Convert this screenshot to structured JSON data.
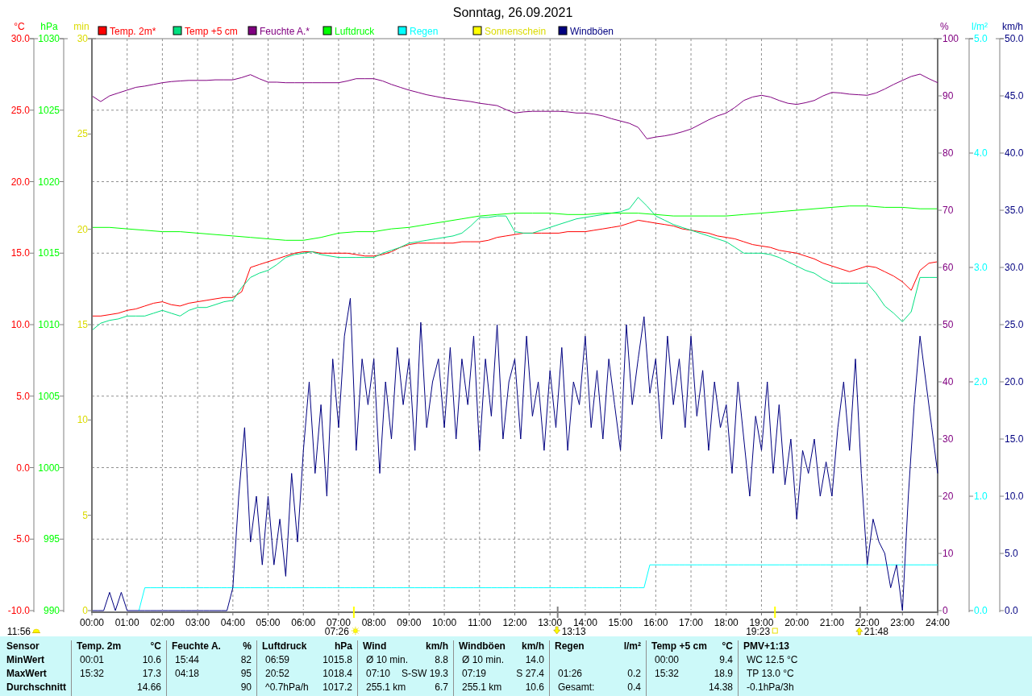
{
  "charts": [
    {
      "chart_data": {
        "type": "line",
        "title": "Sonntag, 26.09.2021",
        "ylabel": "°C",
        "grid": true,
        "legend": "top",
        "xlim": [
          0,
          1440
        ],
        "ylim": [
          -10,
          30
        ],
        "xticks": [
          {
            "value": 0,
            "label": "00:00"
          },
          {
            "value": 60,
            "label": "01:00"
          },
          {
            "value": 120,
            "label": "02:00"
          },
          {
            "value": 180,
            "label": "03:00"
          },
          {
            "value": 240,
            "label": "04:00"
          },
          {
            "value": 300,
            "label": "05:00"
          },
          {
            "value": 360,
            "label": "06:00"
          },
          {
            "value": 420,
            "label": "07:00"
          },
          {
            "value": 480,
            "label": "08:00"
          },
          {
            "value": 540,
            "label": "09:00"
          },
          {
            "value": 600,
            "label": "10:00"
          },
          {
            "value": 660,
            "label": "11:00"
          },
          {
            "value": 720,
            "label": "12:00"
          },
          {
            "value": 780,
            "label": "13:00"
          },
          {
            "value": 840,
            "label": "14:00"
          },
          {
            "value": 900,
            "label": "15:00"
          },
          {
            "value": 960,
            "label": "16:00"
          },
          {
            "value": 1020,
            "label": "17:00"
          },
          {
            "value": 1080,
            "label": "18:00"
          },
          {
            "value": 1140,
            "label": "19:00"
          },
          {
            "value": 1200,
            "label": "20:00"
          },
          {
            "value": 1260,
            "label": "21:00"
          },
          {
            "value": 1320,
            "label": "22:00"
          },
          {
            "value": 1380,
            "label": "23:00"
          },
          {
            "value": 1440,
            "label": "24:00"
          }
        ],
        "yticks": [
          {
            "value": 30,
            "label": "30.0"
          },
          {
            "value": 25,
            "label": "25.0"
          },
          {
            "value": 20,
            "label": "20.0"
          },
          {
            "value": 15,
            "label": "15.0"
          },
          {
            "value": 10,
            "label": "10.0"
          },
          {
            "value": 5,
            "label": "5.0"
          },
          {
            "value": 0,
            "label": "0.0"
          },
          {
            "value": -5,
            "label": "-5.0"
          },
          {
            "value": -10,
            "label": "-10.0"
          }
        ],
        "x": [
          0,
          15,
          30,
          45,
          60,
          75,
          90,
          105,
          120,
          135,
          150,
          165,
          180,
          195,
          210,
          225,
          240,
          255,
          270,
          285,
          300,
          315,
          330,
          345,
          360,
          375,
          390,
          405,
          420,
          435,
          450,
          465,
          480,
          495,
          510,
          525,
          540,
          555,
          570,
          585,
          600,
          615,
          630,
          645,
          660,
          675,
          690,
          705,
          720,
          735,
          750,
          765,
          780,
          795,
          810,
          825,
          840,
          855,
          870,
          885,
          900,
          915,
          930,
          945,
          960,
          975,
          990,
          1005,
          1020,
          1035,
          1050,
          1065,
          1080,
          1095,
          1110,
          1125,
          1140,
          1155,
          1170,
          1185,
          1200,
          1215,
          1230,
          1245,
          1260,
          1275,
          1290,
          1305,
          1320,
          1335,
          1350,
          1365,
          1380,
          1395,
          1410,
          1425,
          1440
        ],
        "series": [
          {
            "name": "Temp. 2m*",
            "color": "#ff0000",
            "values": [
              10.6,
              10.6,
              10.7,
              10.8,
              11.0,
              11.1,
              11.3,
              11.5,
              11.6,
              11.4,
              11.3,
              11.5,
              11.6,
              11.7,
              11.8,
              11.9,
              11.9,
              12.3,
              14.0,
              14.2,
              14.4,
              14.6,
              14.8,
              15.0,
              15.1,
              15.1,
              15.0,
              15.0,
              15.0,
              15.0,
              14.9,
              14.8,
              14.8,
              14.9,
              15.1,
              15.4,
              15.6,
              15.7,
              15.7,
              15.7,
              15.7,
              15.7,
              15.8,
              15.8,
              15.8,
              15.9,
              16.1,
              16.2,
              16.3,
              16.4,
              16.4,
              16.4,
              16.4,
              16.4,
              16.5,
              16.5,
              16.5,
              16.6,
              16.7,
              16.8,
              16.9,
              17.1,
              17.3,
              17.2,
              17.1,
              17.0,
              16.9,
              16.7,
              16.6,
              16.5,
              16.4,
              16.2,
              16.1,
              16.0,
              15.8,
              15.6,
              15.5,
              15.4,
              15.2,
              15.1,
              15.0,
              14.8,
              14.6,
              14.3,
              14.1,
              13.9,
              13.7,
              13.9,
              14.1,
              14.0,
              13.7,
              13.4,
              13.0,
              12.4,
              13.8,
              14.3,
              14.4
            ]
          },
          {
            "name": "Temp +5 cm",
            "color": "#00e080",
            "values": [
              9.6,
              10.1,
              10.3,
              10.4,
              10.6,
              10.6,
              10.6,
              10.8,
              11.0,
              10.8,
              10.6,
              11.0,
              11.2,
              11.2,
              11.4,
              11.6,
              11.7,
              12.6,
              13.3,
              13.6,
              13.8,
              14.2,
              14.7,
              14.9,
              15.0,
              15.1,
              14.9,
              14.8,
              14.7,
              14.7,
              14.7,
              14.7,
              14.7,
              15.0,
              15.2,
              15.4,
              15.7,
              15.8,
              15.9,
              16.0,
              16.1,
              16.2,
              16.4,
              16.9,
              17.5,
              17.5,
              17.6,
              17.6,
              16.5,
              16.4,
              16.4,
              16.6,
              16.8,
              17.0,
              17.2,
              17.4,
              17.5,
              17.6,
              17.7,
              17.8,
              17.9,
              18.1,
              18.9,
              18.3,
              17.6,
              17.3,
              17.0,
              16.8,
              16.6,
              16.4,
              16.2,
              16.0,
              15.8,
              15.4,
              15.0,
              15.0,
              15.0,
              14.9,
              14.7,
              14.4,
              14.1,
              13.8,
              13.6,
              13.2,
              12.9,
              12.9,
              12.9,
              12.9,
              12.9,
              12.2,
              11.3,
              10.8,
              10.2,
              10.9,
              13.3,
              13.3,
              13.3
            ]
          }
        ]
      }
    },
    {
      "chart_data": {
        "type": "line",
        "ylabel": "hPa",
        "legend": "top",
        "ylim": [
          990,
          1030
        ],
        "yticks": [
          1030,
          1025,
          1020,
          1015,
          1010,
          1005,
          1000,
          995,
          990
        ],
        "categories": [
          null,
          null,
          null,
          null,
          null,
          null,
          null,
          null,
          null,
          null,
          null,
          null,
          null,
          null,
          null,
          null,
          null,
          null,
          null,
          null,
          null,
          null,
          null,
          null,
          null,
          null,
          null,
          null,
          null,
          null,
          null,
          null,
          null,
          null,
          null,
          null,
          null,
          null,
          null,
          null,
          null,
          null,
          null,
          null,
          null,
          null,
          null,
          null,
          null
        ],
        "series": [
          {
            "name": "Luftdruck",
            "color": "#00ff00",
            "values": [
              1016.8,
              1016.8,
              1016.7,
              1016.6,
              1016.5,
              1016.5,
              1016.4,
              1016.3,
              1016.2,
              1016.1,
              1016.0,
              1015.9,
              1015.9,
              1016.1,
              1016.4,
              1016.5,
              1016.5,
              1016.7,
              1016.8,
              1017.0,
              1017.2,
              1017.4,
              1017.6,
              1017.7,
              1017.8,
              1017.8,
              1017.8,
              1017.7,
              1017.7,
              1017.8,
              1017.8,
              1017.8,
              1017.7,
              1017.6,
              1017.6,
              1017.6,
              1017.6,
              1017.7,
              1017.8,
              1017.9,
              1018.0,
              1018.1,
              1018.2,
              1018.3,
              1018.3,
              1018.2,
              1018.2,
              1018.1,
              1018.1
            ]
          }
        ]
      }
    },
    {
      "chart_data": {
        "type": "line",
        "ylabel": "%",
        "legend": "top",
        "ylim": [
          0,
          100
        ],
        "yticks": [
          {
            "value": 100,
            "label": "100"
          },
          {
            "value": 90,
            "label": "90"
          },
          {
            "value": 80,
            "label": "80"
          },
          {
            "value": 70,
            "label": "70"
          },
          {
            "value": 60,
            "label": "60"
          },
          {
            "value": 50,
            "label": "50"
          },
          {
            "value": 40,
            "label": "40"
          },
          {
            "value": 30,
            "label": "30"
          },
          {
            "value": 20,
            "label": "20"
          },
          {
            "value": 10,
            "label": "10"
          },
          {
            "value": 0,
            "label": "0"
          }
        ],
        "categories": [
          null,
          null,
          null,
          null,
          null,
          null,
          null,
          null,
          null,
          null,
          null,
          null,
          null,
          null,
          null,
          null,
          null,
          null,
          null,
          null,
          null,
          null,
          null,
          null,
          null,
          null,
          null,
          null,
          null,
          null,
          null,
          null,
          null,
          null,
          null,
          null,
          null,
          null,
          null,
          null,
          null,
          null,
          null,
          null,
          null,
          null,
          null,
          null,
          null,
          null,
          null,
          null,
          null,
          null,
          null,
          null,
          null,
          null,
          null,
          null,
          null,
          null,
          null,
          null,
          null,
          null,
          null,
          null,
          null,
          null,
          null,
          null,
          null,
          null,
          null,
          null,
          null,
          null,
          null,
          null,
          null,
          null,
          null,
          null,
          null,
          null,
          null,
          null,
          null,
          null,
          null,
          null,
          null,
          null,
          null,
          null,
          null
        ],
        "series": [
          {
            "name": "Feuchte A.*",
            "color": "#800080",
            "values": [
              90,
              89,
              90,
              90.5,
              91,
              91.5,
              91.7,
              92,
              92.3,
              92.5,
              92.6,
              92.7,
              92.7,
              92.7,
              92.8,
              92.8,
              92.8,
              93.2,
              93.7,
              93,
              92.4,
              92.4,
              92.3,
              92.3,
              92.3,
              92.3,
              92.3,
              92.3,
              92.3,
              92.6,
              93,
              93,
              93,
              92.6,
              92,
              91.5,
              91,
              90.6,
              90.2,
              89.9,
              89.6,
              89.4,
              89.2,
              89,
              88.7,
              88.5,
              88.3,
              87.6,
              87,
              87.2,
              87.3,
              87.3,
              87.3,
              87.3,
              87.2,
              87,
              87,
              86.8,
              86.5,
              86,
              85.6,
              85.2,
              84.5,
              82.5,
              82.8,
              83,
              83.3,
              83.7,
              84.2,
              85,
              85.8,
              86.5,
              87,
              88,
              89.2,
              89.8,
              90.1,
              89.8,
              89.2,
              88.7,
              88.5,
              88.8,
              89.2,
              90,
              90.6,
              90.5,
              90.3,
              90.2,
              90.1,
              90.5,
              91.2,
              92,
              92.7,
              93.4,
              93.8,
              93,
              92.3
            ]
          }
        ]
      }
    },
    {
      "chart_data": {
        "type": "line",
        "ylabel": "l/m²",
        "y2label": "km/h",
        "legend": "top",
        "ylim": [
          0,
          5
        ],
        "yticks": [
          {
            "value": 5,
            "label": "5.0"
          },
          {
            "value": 4,
            "label": "4.0"
          },
          {
            "value": 3,
            "label": "3.0"
          },
          {
            "value": 2,
            "label": "2.0"
          },
          {
            "value": 1,
            "label": "1.0"
          },
          {
            "value": 0,
            "label": "0.0"
          }
        ],
        "y2lim": [
          0,
          50
        ],
        "y2ticks": [
          {
            "value": 50,
            "label": "50.0"
          },
          {
            "value": 45,
            "label": "45.0"
          },
          {
            "value": 40,
            "label": "40.0"
          },
          {
            "value": 35,
            "label": "35.0"
          },
          {
            "value": 30,
            "label": "30.0"
          },
          {
            "value": 25,
            "label": "25.0"
          },
          {
            "value": 20,
            "label": "20.0"
          },
          {
            "value": 15,
            "label": "15.0"
          },
          {
            "value": 10,
            "label": "10.0"
          },
          {
            "value": 5,
            "label": "5.0"
          },
          {
            "value": 0,
            "label": "0.0"
          }
        ],
        "categories": [
          null,
          null,
          null,
          null,
          null,
          null,
          null,
          null,
          null,
          null,
          null,
          null,
          null,
          null,
          null,
          null,
          null,
          null,
          null,
          null,
          null,
          null,
          null,
          null,
          null,
          null,
          null,
          null,
          null,
          null,
          null,
          null,
          null,
          null,
          null,
          null,
          null,
          null,
          null,
          null,
          null,
          null,
          null,
          null,
          null,
          null,
          null,
          null,
          null,
          null,
          null,
          null,
          null,
          null,
          null,
          null,
          null,
          null,
          null,
          null,
          null,
          null,
          null,
          null,
          null,
          null,
          null,
          null,
          null,
          null,
          null,
          null,
          null,
          null,
          null,
          null,
          null,
          null,
          null,
          null,
          null,
          null,
          null,
          null,
          null,
          null,
          null,
          null,
          null,
          null,
          null,
          null,
          null,
          null,
          null,
          null,
          null,
          null,
          null,
          null,
          null,
          null,
          null,
          null,
          null,
          null,
          null,
          null,
          null,
          null,
          null,
          null,
          null,
          null,
          null,
          null,
          null,
          null,
          null,
          null,
          null,
          null,
          null,
          null,
          null,
          null,
          null,
          null,
          null,
          null,
          null,
          null,
          null,
          null,
          null,
          null,
          null,
          null,
          null,
          null,
          null,
          null,
          null,
          null,
          null
        ],
        "series": [
          {
            "name": "Regen",
            "color": "#00ffff",
            "values": [
              null,
              null,
              null,
              null,
              null,
              null,
              null,
              null,
              0,
              0.2,
              0.2,
              0.2,
              0.2,
              0.2,
              0.2,
              0.2,
              0.2,
              0.2,
              0.2,
              0.2,
              0.2,
              0.2,
              0.2,
              0.2,
              0.2,
              0.2,
              0.2,
              0.2,
              0.2,
              0.2,
              0.2,
              0.2,
              0.2,
              0.2,
              0.2,
              0.2,
              0.2,
              0.2,
              0.2,
              0.2,
              0.2,
              0.2,
              0.2,
              0.2,
              0.2,
              0.2,
              0.2,
              0.2,
              0.2,
              0.2,
              0.2,
              0.2,
              0.2,
              0.2,
              0.2,
              0.2,
              0.2,
              0.2,
              0.2,
              0.2,
              0.2,
              0.2,
              0.2,
              0.2,
              0.2,
              0.2,
              0.2,
              0.2,
              0.2,
              0.2,
              0.2,
              0.2,
              0.2,
              0.2,
              0.2,
              0.2,
              0.2,
              0.2,
              0.2,
              0.2,
              0.2,
              0.2,
              0.2,
              0.2,
              0.2,
              0.2,
              0.2,
              0.2,
              0.2,
              0.2,
              0.2,
              0.2,
              0.2,
              0.2,
              0.2,
              0.4,
              0.4,
              0.4,
              0.4,
              0.4,
              0.4,
              0.4,
              0.4,
              0.4,
              0.4,
              0.4,
              0.4,
              0.4,
              0.4,
              0.4,
              0.4,
              0.4,
              0.4,
              0.4,
              0.4,
              0.4,
              0.4,
              0.4,
              0.4,
              0.4,
              0.4,
              0.4,
              0.4,
              0.4,
              0.4,
              0.4,
              0.4,
              0.4,
              0.4,
              0.4,
              0.4,
              0.4,
              0.4,
              0.4,
              0.4,
              0.4,
              0.4,
              0.4,
              0.4,
              0.4,
              0.4,
              0.4,
              0.4,
              0.4,
              0.4
            ]
          },
          {
            "name": "Windböen",
            "color": "#000080",
            "axis": "y2",
            "values": [
              0,
              0,
              0,
              1.6,
              0,
              1.6,
              0,
              0,
              0,
              0,
              0,
              0,
              0,
              0,
              0,
              0,
              0,
              0,
              0,
              0,
              0,
              0,
              0,
              0,
              2,
              10,
              16,
              6,
              10,
              4,
              10,
              4,
              8,
              3,
              12,
              6,
              14,
              20,
              12,
              18,
              10,
              22,
              16,
              24,
              27.3,
              14,
              22,
              18,
              22,
              12,
              20,
              15,
              23,
              18,
              22,
              14,
              25.2,
              16,
              20,
              22,
              16,
              23,
              15,
              22,
              18,
              24,
              14,
              22,
              17,
              25,
              15,
              20,
              22,
              15,
              24,
              17,
              20,
              14,
              21,
              16,
              23,
              14,
              20,
              18,
              24,
              16,
              21,
              15,
              22,
              18,
              14,
              25,
              18,
              22,
              25.7,
              19,
              22,
              15,
              24,
              18,
              22,
              16,
              24,
              17,
              21,
              14,
              20,
              16,
              18,
              12,
              20,
              15,
              10,
              17,
              14,
              20,
              12,
              18,
              11,
              15,
              8,
              14,
              12,
              15,
              10,
              13,
              10,
              16,
              20,
              14,
              22,
              12,
              4,
              8,
              6,
              5,
              2,
              4,
              0,
              10,
              18,
              24,
              20,
              16,
              12
            ]
          }
        ]
      }
    }
  ],
  "sunshine": {
    "axis_unit": "min",
    "axis_ticks": [
      "30",
      "25",
      "20",
      "15",
      "10",
      "5",
      "0"
    ],
    "legend_label": "Sonnenschein",
    "color": "#ffff00"
  },
  "markers": [
    {
      "kind": "sunrise",
      "time": "07:26"
    },
    {
      "kind": "moonset",
      "time": "13:13"
    },
    {
      "kind": "sunset",
      "time": "19:23"
    },
    {
      "kind": "moonrise",
      "time": "21:48"
    }
  ],
  "day_length": "11:56",
  "stats": {
    "row_labels": [
      "Sensor",
      "MinWert",
      "MaxWert",
      "Durchschnitt"
    ],
    "columns": [
      {
        "title": "Temp. 2m",
        "unit": "°C",
        "min": {
          "label": "00:01",
          "value": "10.6"
        },
        "max": {
          "label": "15:32",
          "value": "17.3"
        },
        "avg": {
          "value": "14.66"
        }
      },
      {
        "title": "Feuchte A.",
        "unit": "%",
        "min": {
          "label": "15:44",
          "value": "82"
        },
        "max": {
          "label": "04:18",
          "value": "95"
        },
        "avg": {
          "value": "90"
        }
      },
      {
        "title": "Luftdruck",
        "unit": "hPa",
        "min": {
          "label": "06:59",
          "value": "1015.8"
        },
        "max": {
          "label": "20:52",
          "value": "1018.4"
        },
        "avg": {
          "label": "^0.7hPa/h",
          "value": "1017.2"
        }
      },
      {
        "title": "Wind",
        "unit": "km/h",
        "min": {
          "label": "Ø 10 min.",
          "value": "8.8"
        },
        "max": {
          "label": "07:10",
          "value": "S-SW 19.3"
        },
        "avg": {
          "label": "255.1 km",
          "value": "6.7"
        }
      },
      {
        "title": "Windböen",
        "unit": "km/h",
        "min": {
          "label": "Ø 10 min.",
          "value": "14.0"
        },
        "max": {
          "label": "07:19",
          "value": "S 27.4"
        },
        "avg": {
          "label": "255.1 km",
          "value": "10.6"
        }
      },
      {
        "title": "Regen",
        "unit": "l/m²",
        "max": {
          "label": "01:26",
          "value": "0.2"
        },
        "avg": {
          "label": "Gesamt:",
          "value": "0.4"
        }
      },
      {
        "title": "Temp +5 cm",
        "unit": "°C",
        "min": {
          "label": "00:00",
          "value": "9.4"
        },
        "max": {
          "label": "15:32",
          "value": "18.9"
        },
        "avg": {
          "value": "14.38"
        }
      },
      {
        "title": "PMV+1:13",
        "min": {
          "label": "WC 12.5 °C"
        },
        "max": {
          "label": "TP 13.0 °C"
        },
        "avg": {
          "label": "-0.1hPa/3h"
        }
      }
    ]
  }
}
